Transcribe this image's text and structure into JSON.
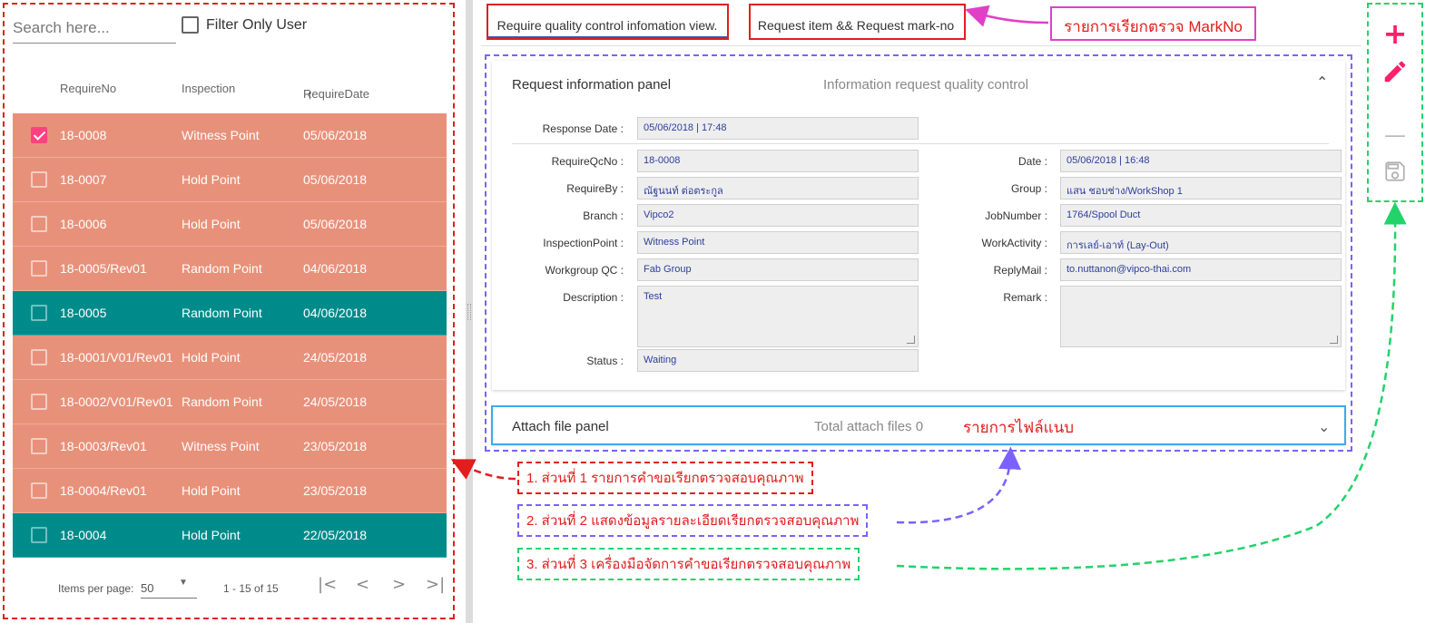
{
  "left": {
    "search_placeholder": "Search here...",
    "filter_label": "Filter Only User",
    "columns": [
      "RequireNo",
      "Inspection",
      "RequireDate"
    ],
    "sort_arrow": "↑",
    "rows": [
      {
        "no": "18-0008",
        "inspection": "Witness Point",
        "date": "05/06/2018",
        "checked": true,
        "color": "salmon"
      },
      {
        "no": "18-0007",
        "inspection": "Hold Point",
        "date": "05/06/2018",
        "checked": false,
        "color": "salmon"
      },
      {
        "no": "18-0006",
        "inspection": "Hold Point",
        "date": "05/06/2018",
        "checked": false,
        "color": "salmon"
      },
      {
        "no": "18-0005/Rev01",
        "inspection": "Random Point",
        "date": "04/06/2018",
        "checked": false,
        "color": "salmon"
      },
      {
        "no": "18-0005",
        "inspection": "Random Point",
        "date": "04/06/2018",
        "checked": false,
        "color": "teal"
      },
      {
        "no": "18-0001/V01/Rev01",
        "inspection": "Hold Point",
        "date": "24/05/2018",
        "checked": false,
        "color": "salmon"
      },
      {
        "no": "18-0002/V01/Rev01",
        "inspection": "Random Point",
        "date": "24/05/2018",
        "checked": false,
        "color": "salmon"
      },
      {
        "no": "18-0003/Rev01",
        "inspection": "Witness Point",
        "date": "23/05/2018",
        "checked": false,
        "color": "salmon"
      },
      {
        "no": "18-0004/Rev01",
        "inspection": "Hold Point",
        "date": "23/05/2018",
        "checked": false,
        "color": "salmon"
      },
      {
        "no": "18-0004",
        "inspection": "Hold Point",
        "date": "22/05/2018",
        "checked": false,
        "color": "teal"
      }
    ],
    "paginator": {
      "items_per_page_label": "Items per page:",
      "items_per_page_value": "50",
      "range": "1 - 15 of 15"
    }
  },
  "tabs": {
    "tab1": "Require quality control infomation view.",
    "tab2": "Request item && Request mark-no",
    "tab2_note": "รายการเรียกตรวจ MarkNo"
  },
  "panel": {
    "title": "Request information panel",
    "description": "Information request quality control",
    "fields": {
      "response_date": {
        "label": "Response Date :",
        "value": "05/06/2018 | 17:48"
      },
      "require_qc_no": {
        "label": "RequireQcNo :",
        "value": "18-0008"
      },
      "require_by": {
        "label": "RequireBy :",
        "value": "ณัฐนนท์ ต่อตระกูล"
      },
      "branch": {
        "label": "Branch :",
        "value": "Vipco2"
      },
      "inspection_point": {
        "label": "InspectionPoint :",
        "value": "Witness Point"
      },
      "workgroup_qc": {
        "label": "Workgroup QC :",
        "value": "Fab Group"
      },
      "description": {
        "label": "Description :",
        "value": "Test"
      },
      "status": {
        "label": "Status :",
        "value": "Waiting"
      },
      "date": {
        "label": "Date :",
        "value": "05/06/2018 | 16:48"
      },
      "group": {
        "label": "Group :",
        "value": "แสน ชอบช่าง/WorkShop 1"
      },
      "job_number": {
        "label": "JobNumber :",
        "value": "1764/Spool Duct"
      },
      "work_activity": {
        "label": "WorkActivity :",
        "value": "การเลย์-เอาท์ (Lay-Out)"
      },
      "reply_mail": {
        "label": "ReplyMail :",
        "value": "to.nuttanon@vipco-thai.com"
      },
      "remark": {
        "label": "Remark :",
        "value": ""
      }
    }
  },
  "attach": {
    "title": "Attach file panel",
    "description": "Total attach files 0",
    "note": "รายการไฟล์แนบ"
  },
  "notes": {
    "part1": "1. ส่วนที่ 1 รายการคำขอเรียกตรวจสอบคุณภาพ",
    "part2": "2. ส่วนที่ 2 แสดงข้อมูลรายละเอียดเรียกตรวจสอบคุณภาพ",
    "part3": "3. ส่วนที่ 3 เครื่องมือจัดการคำขอเรียกตรวจสอบคุณภาพ"
  },
  "toolbar": {
    "add_icon": "plus-icon",
    "edit_icon": "pencil-icon",
    "remove_icon": "minus-icon",
    "save_icon": "floppy-icon"
  },
  "colors": {
    "row_salmon": "#e8917a",
    "row_teal": "#008b8b",
    "check_pink": "#ff4081",
    "accent_pink": "#ff1f6b",
    "annotation_red": "#e11d1d",
    "annotation_purple": "#7b61ff",
    "annotation_green": "#22d36a",
    "annotation_blue": "#3fa9e8"
  }
}
